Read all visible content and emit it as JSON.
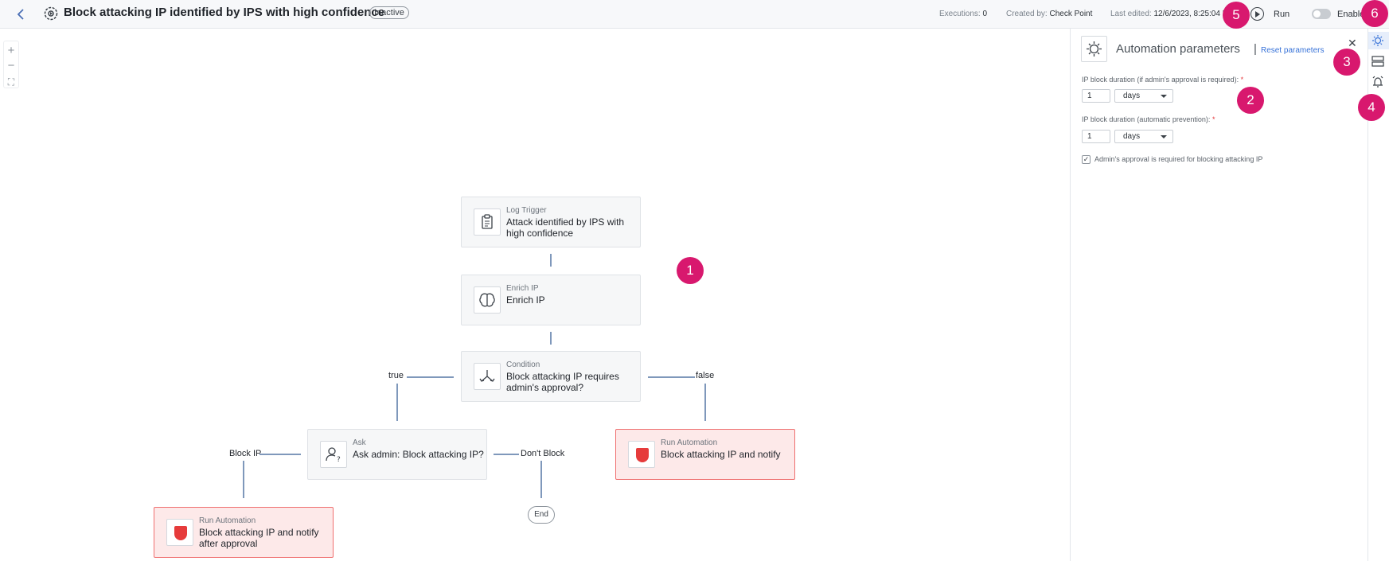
{
  "header": {
    "title": "Block attacking IP identified by IPS with high confidence",
    "status_badge": "Inactive",
    "executions_label": "Executions:",
    "executions_value": "0",
    "created_by_label": "Created by:",
    "created_by_value": "Check Point",
    "last_edited_label": "Last edited:",
    "last_edited_value": "12/6/2023, 8:25:04 PM",
    "run_label": "Run",
    "enable_label": "Enable",
    "enabled": false
  },
  "canvas": {
    "zoom_controls": [
      "+",
      "−",
      "⛶"
    ],
    "nodes": {
      "trigger": {
        "type": "Log Trigger",
        "name": "Attack identified by IPS with high confidence"
      },
      "enrich": {
        "type": "Enrich IP",
        "name": "Enrich IP"
      },
      "condition": {
        "type": "Condition",
        "name": "Block attacking IP requires admin's approval?"
      },
      "ask": {
        "type": "Ask",
        "name": "Ask admin: Block attacking IP?"
      },
      "run_false": {
        "type": "Run Automation",
        "name": "Block attacking IP and notify"
      },
      "run_approved": {
        "type": "Run Automation",
        "name": "Block attacking IP and notify after approval"
      },
      "end": "End"
    },
    "edge_labels": {
      "true": "true",
      "false": "false",
      "block_ip": "Block IP",
      "dont_block": "Don't Block"
    }
  },
  "panel": {
    "title": "Automation parameters",
    "separator": "|",
    "reset_label": "Reset parameters",
    "close": "✕",
    "fields": [
      {
        "label": "IP block duration (if admin's approval is required):",
        "required": "*",
        "value": "1",
        "unit": "days"
      },
      {
        "label": "IP block duration (automatic prevention):",
        "required": "*",
        "value": "1",
        "unit": "days"
      }
    ],
    "checkbox": {
      "label": "Admin's approval is required for blocking attacking IP",
      "checked": true,
      "mark": "✓"
    }
  },
  "side_rail": {
    "icons": [
      "automation-parameters-icon",
      "layout-icon",
      "alarm-icon"
    ]
  },
  "callouts": [
    "1",
    "2",
    "3",
    "4",
    "5",
    "6"
  ],
  "colors": {
    "accent": "#3873d8",
    "callout": "#d8186e",
    "run_automation_bg": "#fde9e9",
    "run_automation_border": "#ef6f6f",
    "edge": "#7f98bb"
  }
}
